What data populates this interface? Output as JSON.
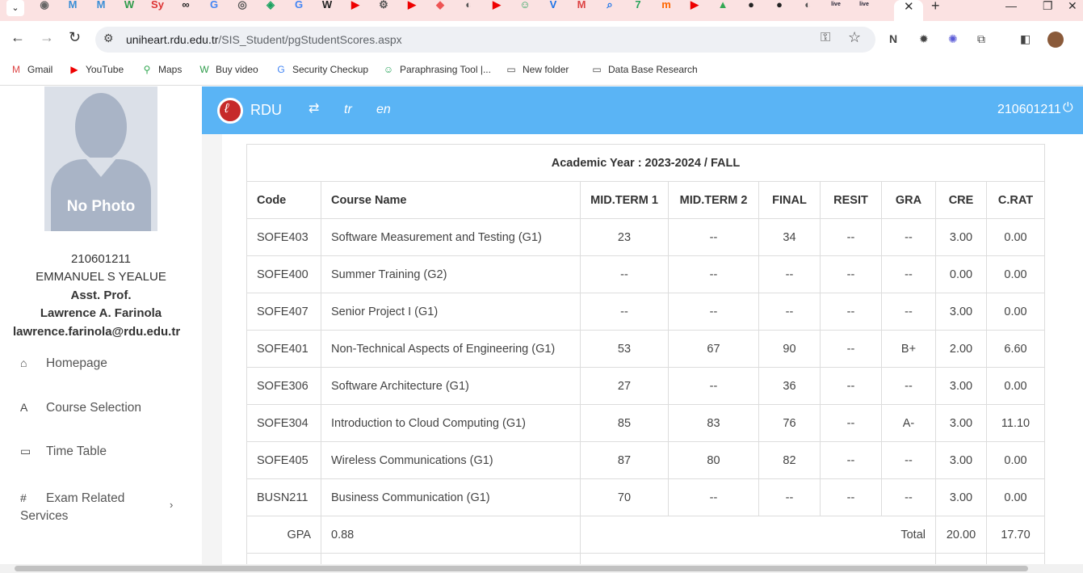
{
  "browser": {
    "favicons": [
      {
        "name": "unknown",
        "color": "#666",
        "glyph": "◉"
      },
      {
        "name": "m-logo",
        "color": "#3b8fd6",
        "glyph": "M"
      },
      {
        "name": "m-logo",
        "color": "#3b8fd6",
        "glyph": "M"
      },
      {
        "name": "w-logo",
        "color": "#2e9b4a",
        "glyph": "W"
      },
      {
        "name": "sy-logo",
        "color": "#d33",
        "glyph": "Sy"
      },
      {
        "name": "infinity",
        "color": "#222",
        "glyph": "∞"
      },
      {
        "name": "google",
        "color": "#4285f4",
        "glyph": "G"
      },
      {
        "name": "scan",
        "color": "#555",
        "glyph": "◎"
      },
      {
        "name": "shield",
        "color": "#1aa260",
        "glyph": "◈"
      },
      {
        "name": "google",
        "color": "#4285f4",
        "glyph": "G"
      },
      {
        "name": "wikipedia",
        "color": "#222",
        "glyph": "W"
      },
      {
        "name": "youtube",
        "color": "#e00",
        "glyph": "▶"
      },
      {
        "name": "gear",
        "color": "#555",
        "glyph": "⚙"
      },
      {
        "name": "youtube",
        "color": "#e00",
        "glyph": "▶"
      },
      {
        "name": "diamond",
        "color": "#e55",
        "glyph": "◆"
      },
      {
        "name": "globe",
        "color": "#555",
        "glyph": "◐"
      },
      {
        "name": "youtube",
        "color": "#e00",
        "glyph": "▶"
      },
      {
        "name": "robot",
        "color": "#2aa45c",
        "glyph": "☺"
      },
      {
        "name": "v-logo",
        "color": "#1a73e8",
        "glyph": "V"
      },
      {
        "name": "gmail",
        "color": "#d44",
        "glyph": "M"
      },
      {
        "name": "search",
        "color": "#1a73e8",
        "glyph": "⌕"
      },
      {
        "name": "seven",
        "color": "#2aa45c",
        "glyph": "7"
      },
      {
        "name": "m-orange",
        "color": "#f60",
        "glyph": "m"
      },
      {
        "name": "youtube",
        "color": "#e00",
        "glyph": "▶"
      },
      {
        "name": "drive",
        "color": "#34a853",
        "glyph": "▲"
      },
      {
        "name": "github",
        "color": "#222",
        "glyph": "●"
      },
      {
        "name": "github",
        "color": "#222",
        "glyph": "●"
      },
      {
        "name": "globe",
        "color": "#555",
        "glyph": "◐"
      },
      {
        "name": "live",
        "color": "#223",
        "glyph": "live"
      },
      {
        "name": "live",
        "color": "#223",
        "glyph": "live"
      }
    ],
    "url_host": "uniheart.rdu.edu.tr",
    "url_path": "/SIS_Student/pgStudentScores.aspx",
    "bookmarks": [
      {
        "icon": "gmail-icon",
        "glyph": "M",
        "color": "#d44",
        "label": "Gmail"
      },
      {
        "icon": "youtube-icon",
        "glyph": "▶",
        "color": "#e00",
        "label": "YouTube"
      },
      {
        "icon": "maps-icon",
        "glyph": "⚲",
        "color": "#34a853",
        "label": "Maps"
      },
      {
        "icon": "w-icon",
        "glyph": "W",
        "color": "#2e9b4a",
        "label": "Buy video"
      },
      {
        "icon": "google-icon",
        "glyph": "G",
        "color": "#4285f4",
        "label": "Security Checkup"
      },
      {
        "icon": "robot-icon",
        "glyph": "☺",
        "color": "#2aa45c",
        "label": "Paraphrasing Tool |..."
      },
      {
        "icon": "folder-icon",
        "glyph": "▭",
        "color": "#444",
        "label": "New folder"
      },
      {
        "icon": "folder-icon",
        "glyph": "▭",
        "color": "#444",
        "label": "Data Base Research"
      }
    ]
  },
  "sidebar": {
    "photo_text": "No Photo",
    "student_id": "210601211",
    "student_name": "EMMANUEL S YEALUE",
    "advisor_title": "Asst. Prof.",
    "advisor_name": "Lawrence A. Farinola",
    "advisor_email": "lawrence.farinola@rdu.edu.tr",
    "menu": [
      {
        "icon": "home-icon",
        "label": "Homepage"
      },
      {
        "icon": "course-selection-icon",
        "label": "Course Selection"
      },
      {
        "icon": "timetable-icon",
        "label": "Time Table"
      },
      {
        "icon": "exam-icon",
        "label": "Exam Related Services"
      }
    ]
  },
  "topbar": {
    "brand": "RDU",
    "lang_tr": "tr",
    "lang_en": "en",
    "student_id": "210601211"
  },
  "scores": {
    "caption": "Academic Year : 2023-2024 / FALL",
    "headers": [
      "Code",
      "Course Name",
      "MID.TERM 1",
      "MID.TERM 2",
      "FINAL",
      "RESIT",
      "GRA",
      "CRE",
      "C.RAT"
    ],
    "rows": [
      [
        "SOFE403",
        "Software Measurement and Testing (G1)",
        "23",
        "--",
        "34",
        "--",
        "--",
        "3.00",
        "0.00"
      ],
      [
        "SOFE400",
        "Summer Training (G2)",
        "--",
        "--",
        "--",
        "--",
        "--",
        "0.00",
        "0.00"
      ],
      [
        "SOFE407",
        "Senior Project I (G1)",
        "--",
        "--",
        "--",
        "--",
        "--",
        "3.00",
        "0.00"
      ],
      [
        "SOFE401",
        "Non-Technical Aspects of Engineering (G1)",
        "53",
        "67",
        "90",
        "--",
        "B+",
        "2.00",
        "6.60"
      ],
      [
        "SOFE306",
        "Software Architecture (G1)",
        "27",
        "--",
        "36",
        "--",
        "--",
        "3.00",
        "0.00"
      ],
      [
        "SOFE304",
        "Introduction to Cloud Computing (G1)",
        "85",
        "83",
        "76",
        "--",
        "A-",
        "3.00",
        "11.10"
      ],
      [
        "SOFE405",
        "Wireless Communications (G1)",
        "87",
        "80",
        "82",
        "--",
        "--",
        "3.00",
        "0.00"
      ],
      [
        "BUSN211",
        "Business Communication (G1)",
        "70",
        "--",
        "--",
        "--",
        "--",
        "3.00",
        "0.00"
      ]
    ],
    "gpa_label": "GPA",
    "gpa_value": "0.88",
    "total_label": "Total",
    "total_credits": "20.00",
    "total_rating": "17.70"
  }
}
